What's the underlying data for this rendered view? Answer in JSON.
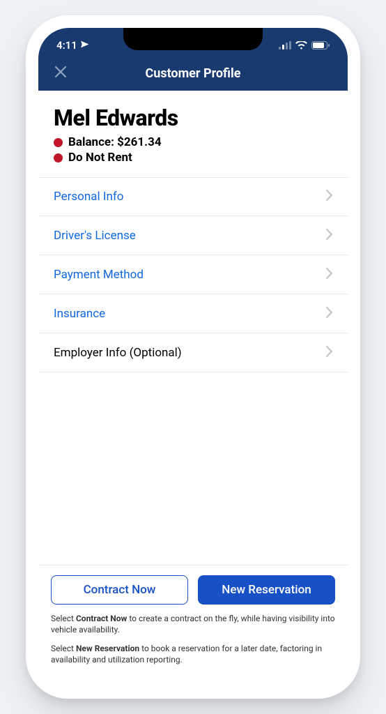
{
  "statusbar": {
    "time": "4:11"
  },
  "header": {
    "title": "Customer Profile"
  },
  "customer": {
    "name": "Mel Edwards",
    "balance_label": "Balance: $261.34",
    "do_not_rent_label": "Do Not Rent"
  },
  "sections": {
    "personal_info": "Personal Info",
    "drivers_license": "Driver's License",
    "payment_method": "Payment Method",
    "insurance": "Insurance",
    "employer_info": "Employer Info (Optional)"
  },
  "footer": {
    "contract_now": "Contract Now",
    "new_reservation": "New Reservation",
    "hint1_prefix": "Select ",
    "hint1_bold": "Contract Now",
    "hint1_suffix": " to create a contract on the fly, while having visibility into vehicle availability.",
    "hint2_prefix": "Select ",
    "hint2_bold": "New Reservation",
    "hint2_suffix": " to book a reservation for a later date, factoring in availability and utilization reporting."
  }
}
